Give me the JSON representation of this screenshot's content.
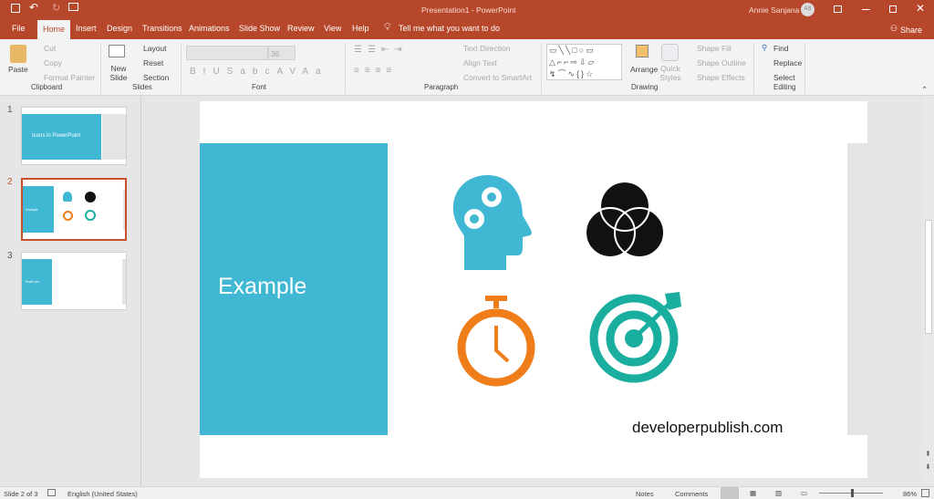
{
  "titlebar": {
    "title": "Presentation1  -  PowerPoint",
    "user": "Annie Sanjana",
    "initials": "AS",
    "share": "Share"
  },
  "tabs": [
    "File",
    "Home",
    "Insert",
    "Design",
    "Transitions",
    "Animations",
    "Slide Show",
    "Review",
    "View",
    "Help"
  ],
  "tell_me": "Tell me what you want to do",
  "ribbon": {
    "clipboard": {
      "paste": "Paste",
      "cut": "Cut",
      "copy": "Copy",
      "format_painter": "Format Painter",
      "label": "Clipboard"
    },
    "slides": {
      "new_slide": "New Slide",
      "layout": "Layout",
      "reset": "Reset",
      "section": "Section",
      "label": "Slides"
    },
    "font": {
      "size": "36",
      "label": "Font"
    },
    "paragraph": {
      "text_direction": "Text Direction",
      "align_text": "Align Text",
      "smartart": "Convert to SmartArt",
      "label": "Paragraph"
    },
    "drawing": {
      "arrange": "Arrange",
      "quick_styles": "Quick Styles",
      "shape_fill": "Shape Fill",
      "shape_outline": "Shape Outline",
      "shape_effects": "Shape Effects",
      "label": "Drawing"
    },
    "editing": {
      "find": "Find",
      "replace": "Replace",
      "select": "Select",
      "label": "Editing"
    }
  },
  "thumbnails": [
    {
      "num": "1",
      "title": "Icons in PowerPoint"
    },
    {
      "num": "2",
      "title": "Example"
    },
    {
      "num": "3",
      "title": "Thank you"
    }
  ],
  "slide": {
    "title": "Example",
    "website": "developerpublish.com"
  },
  "colors": {
    "accent": "#b7472a",
    "blue": "#40b8d4",
    "orange": "#ef7d1a",
    "teal": "#1aae9f"
  },
  "status": {
    "slide": "Slide 2 of 3",
    "language": "English (United States)",
    "notes": "Notes",
    "comments": "Comments",
    "zoom": "86%"
  }
}
